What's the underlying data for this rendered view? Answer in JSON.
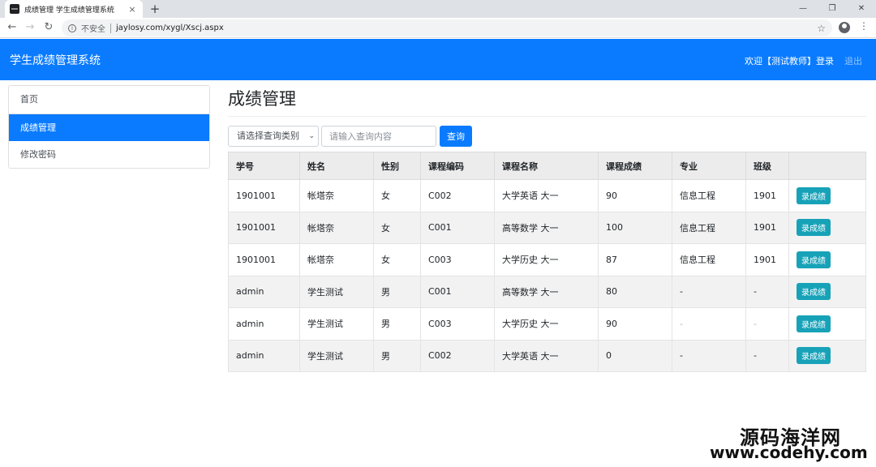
{
  "browser": {
    "tab_title": "成绩管理 学生成绩管理系统",
    "tab_close": "×",
    "new_tab": "+",
    "insecure_label": "不安全",
    "url": "jaylosy.com/xygl/Xscj.aspx",
    "controls": {
      "minimize": "—",
      "restore": "❐",
      "close": "✕"
    }
  },
  "header": {
    "brand": "学生成绩管理系统",
    "welcome": "欢迎【测试教师】登录",
    "logout": "退出"
  },
  "sidebar": {
    "items": [
      {
        "label": "首页",
        "active": false
      },
      {
        "label": "成绩管理",
        "active": true
      },
      {
        "label": "修改密码",
        "active": false
      }
    ]
  },
  "main": {
    "title": "成绩管理",
    "search": {
      "select_value": "请选择查询类别",
      "input_placeholder": "请输入查询内容",
      "button_label": "查询"
    },
    "table": {
      "headers": [
        "学号",
        "姓名",
        "性别",
        "课程编码",
        "课程名称",
        "课程成绩",
        "专业",
        "班级",
        ""
      ],
      "action_label": "录成绩",
      "rows": [
        [
          "1901001",
          "帐塔奈",
          "女",
          "C002",
          "大学英语 大一",
          "90",
          "信息工程",
          "1901"
        ],
        [
          "1901001",
          "帐塔奈",
          "女",
          "C001",
          "高等数学 大一",
          "100",
          "信息工程",
          "1901"
        ],
        [
          "1901001",
          "帐塔奈",
          "女",
          "C003",
          "大学历史 大一",
          "87",
          "信息工程",
          "1901"
        ],
        [
          "admin",
          "学生测试",
          "男",
          "C001",
          "高等数学 大一",
          "80",
          "-",
          "-"
        ],
        [
          "admin",
          "学生测试",
          "男",
          "C003",
          "大学历史 大一",
          "90",
          "-",
          "-"
        ],
        [
          "admin",
          "学生测试",
          "男",
          "C002",
          "大学英语 大一",
          "0",
          "-",
          "-"
        ]
      ]
    }
  },
  "watermark": {
    "line1": "源码海洋网",
    "line2": "www.codehy.com"
  },
  "colors": {
    "primary": "#0a7bff",
    "info_button": "#17a2b8"
  }
}
